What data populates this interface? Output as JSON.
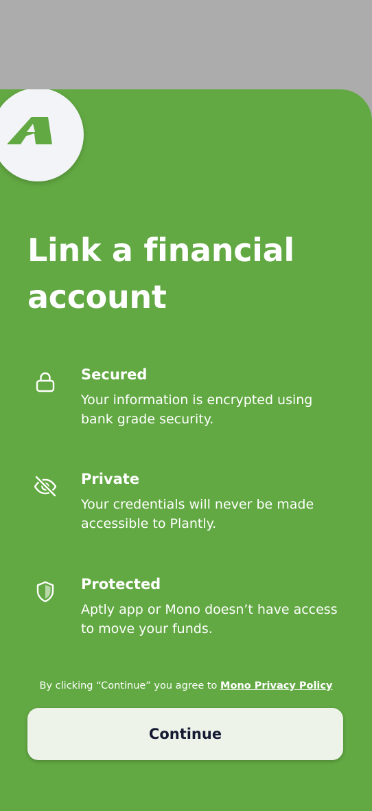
{
  "colors": {
    "backdrop": "#acacac",
    "sheet": "#62a943",
    "logo_bg": "#f2f4f7",
    "button_bg": "#eef3ea",
    "button_text": "#151a33"
  },
  "header": {
    "logo_icon": "brand-mountain-logo-icon",
    "title": "Link a financial account"
  },
  "features": [
    {
      "icon": "lock-icon",
      "title": "Secured",
      "description": "Your information is encrypted using bank grade security."
    },
    {
      "icon": "eye-off-icon",
      "title": "Private",
      "description": "Your credentials will never be made accessible to Plantly."
    },
    {
      "icon": "shield-icon",
      "title": "Protected",
      "description": "Aptly app or Mono doesn’t have access to move your funds."
    }
  ],
  "consent": {
    "prefix": "By clicking “Continue” you agree to",
    "link_text": "Mono Privacy Policy"
  },
  "actions": {
    "continue_label": "Continue"
  }
}
